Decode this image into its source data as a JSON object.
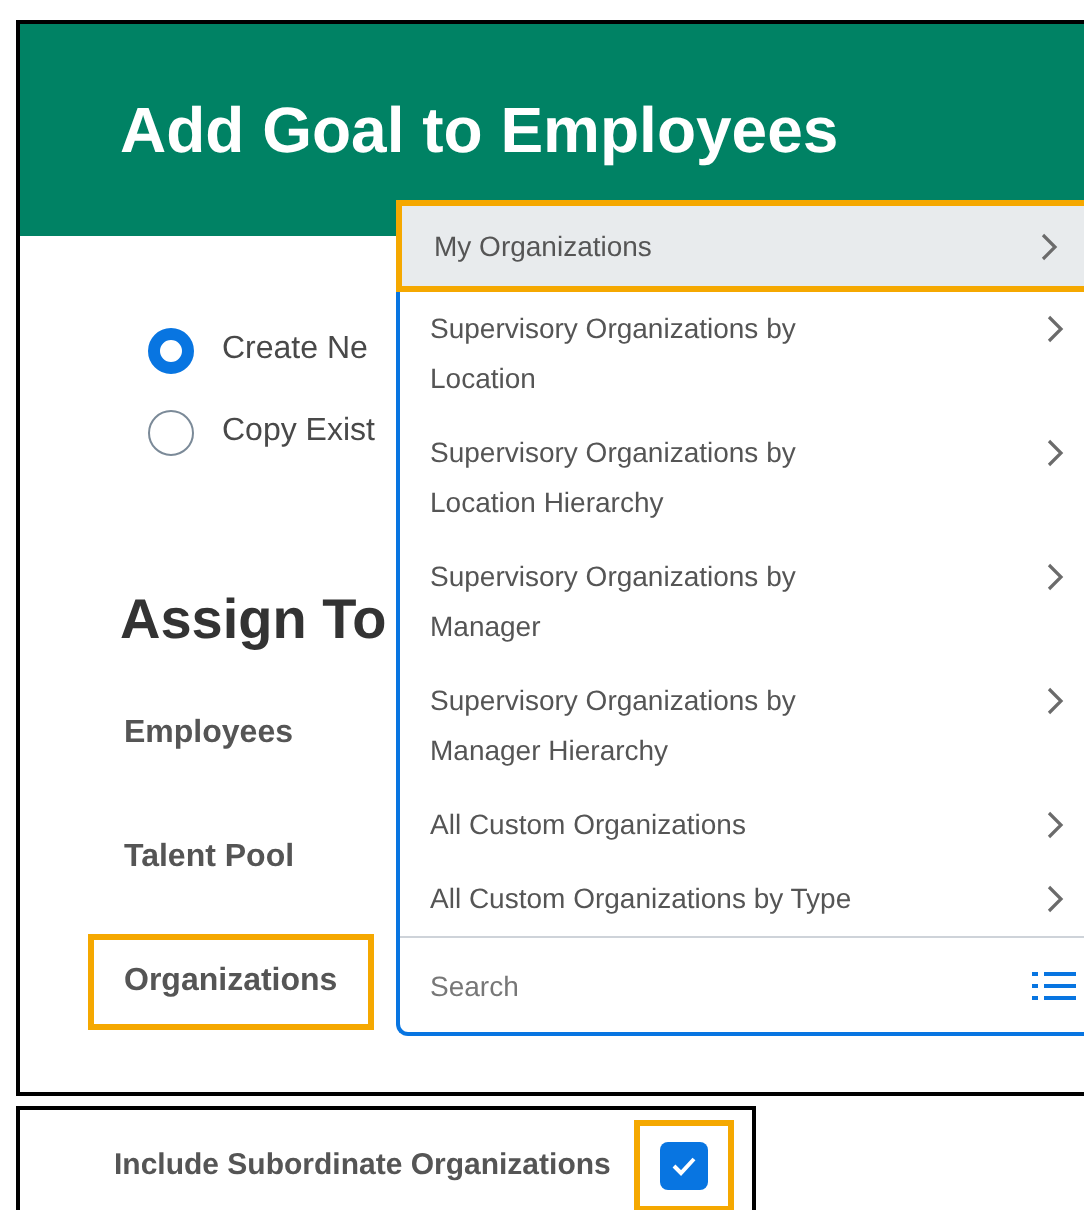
{
  "header": {
    "title": "Add Goal to Employees"
  },
  "options": [
    {
      "label": "Create Ne",
      "selected": true
    },
    {
      "label": "Copy Exist",
      "selected": false
    }
  ],
  "section_title": "Assign To",
  "fields": [
    {
      "label": "Employees",
      "highlighted": false
    },
    {
      "label": "Talent Pool",
      "highlighted": false
    },
    {
      "label": "Organizations",
      "highlighted": true
    }
  ],
  "dropdown": {
    "items": [
      {
        "label": "My Organizations",
        "selected": true
      },
      {
        "label": "Supervisory Organizations by Location",
        "selected": false
      },
      {
        "label": "Supervisory Organizations by Location Hierarchy",
        "selected": false
      },
      {
        "label": "Supervisory Organizations by Manager",
        "selected": false
      },
      {
        "label": "Supervisory Organizations by Manager Hierarchy",
        "selected": false
      },
      {
        "label": "All Custom Organizations",
        "selected": false
      },
      {
        "label": "All Custom Organizations by Type",
        "selected": false
      }
    ],
    "search": {
      "placeholder": "Search"
    }
  },
  "include_subordinates": {
    "label": "Include Subordinate Organizations",
    "checked": true,
    "highlighted": true
  }
}
